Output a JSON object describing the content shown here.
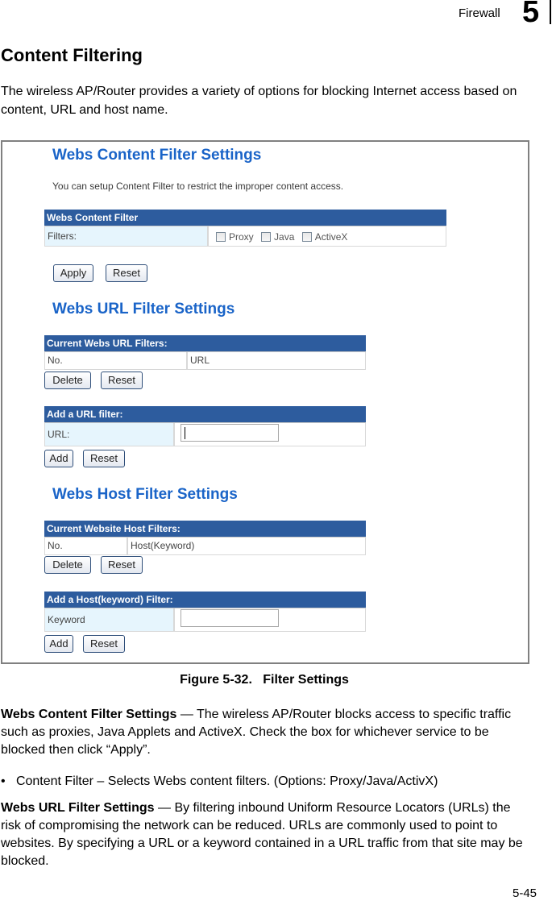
{
  "page_header": {
    "chapter_title": "Firewall",
    "chapter_number": "5"
  },
  "section": {
    "title": "Content Filtering",
    "intro": "The wireless AP/Router provides a variety of options for blocking Internet access based on content, URL and host name."
  },
  "figure": {
    "content_filter": {
      "heading": "Webs Content Filter Settings",
      "description": "You can setup Content Filter to restrict the improper content access.",
      "table_header": "Webs Content Filter",
      "row_label": "Filters:",
      "checkboxes": [
        {
          "label": "Proxy",
          "checked": false
        },
        {
          "label": "Java",
          "checked": false
        },
        {
          "label": "ActiveX",
          "checked": false
        }
      ],
      "apply_label": "Apply",
      "reset_label": "Reset"
    },
    "url_filter": {
      "heading": "Webs URL Filter Settings",
      "current_header": "Current Webs URL Filters:",
      "col_no": "No.",
      "col_url": "URL",
      "delete_label": "Delete",
      "reset_label": "Reset",
      "add_header": "Add a URL filter:",
      "add_row_label": "URL:",
      "url_value": "",
      "add_label": "Add",
      "add_reset_label": "Reset"
    },
    "host_filter": {
      "heading": "Webs Host Filter Settings",
      "current_header": "Current Website Host Filters:",
      "col_no": "No.",
      "col_host": "Host(Keyword)",
      "delete_label": "Delete",
      "reset_label": "Reset",
      "add_header": "Add a Host(keyword) Filter:",
      "add_row_label": "Keyword",
      "keyword_value": "",
      "add_label": "Add",
      "add_reset_label": "Reset"
    },
    "caption": "Figure 5-32.   Filter Settings"
  },
  "body": {
    "p1_bold": "Webs Content Filter Settings",
    "p1_text": " — The wireless AP/Router blocks access to specific traffic such as proxies, Java Applets and ActiveX. Check the box for whichever service to be blocked then click “Apply”.",
    "bullet": "•   Content Filter – Selects Webs content filters. (Options: Proxy/Java/ActivX)",
    "p2_bold": "Webs URL Filter Settings",
    "p2_text": " — By filtering inbound Uniform Resource Locators (URLs) the risk of compromising the network can be reduced. URLs are commonly used to point to websites. By specifying a URL or a keyword contained in a URL traffic from that site may be blocked."
  },
  "footer": {
    "page_number": "5-45"
  }
}
